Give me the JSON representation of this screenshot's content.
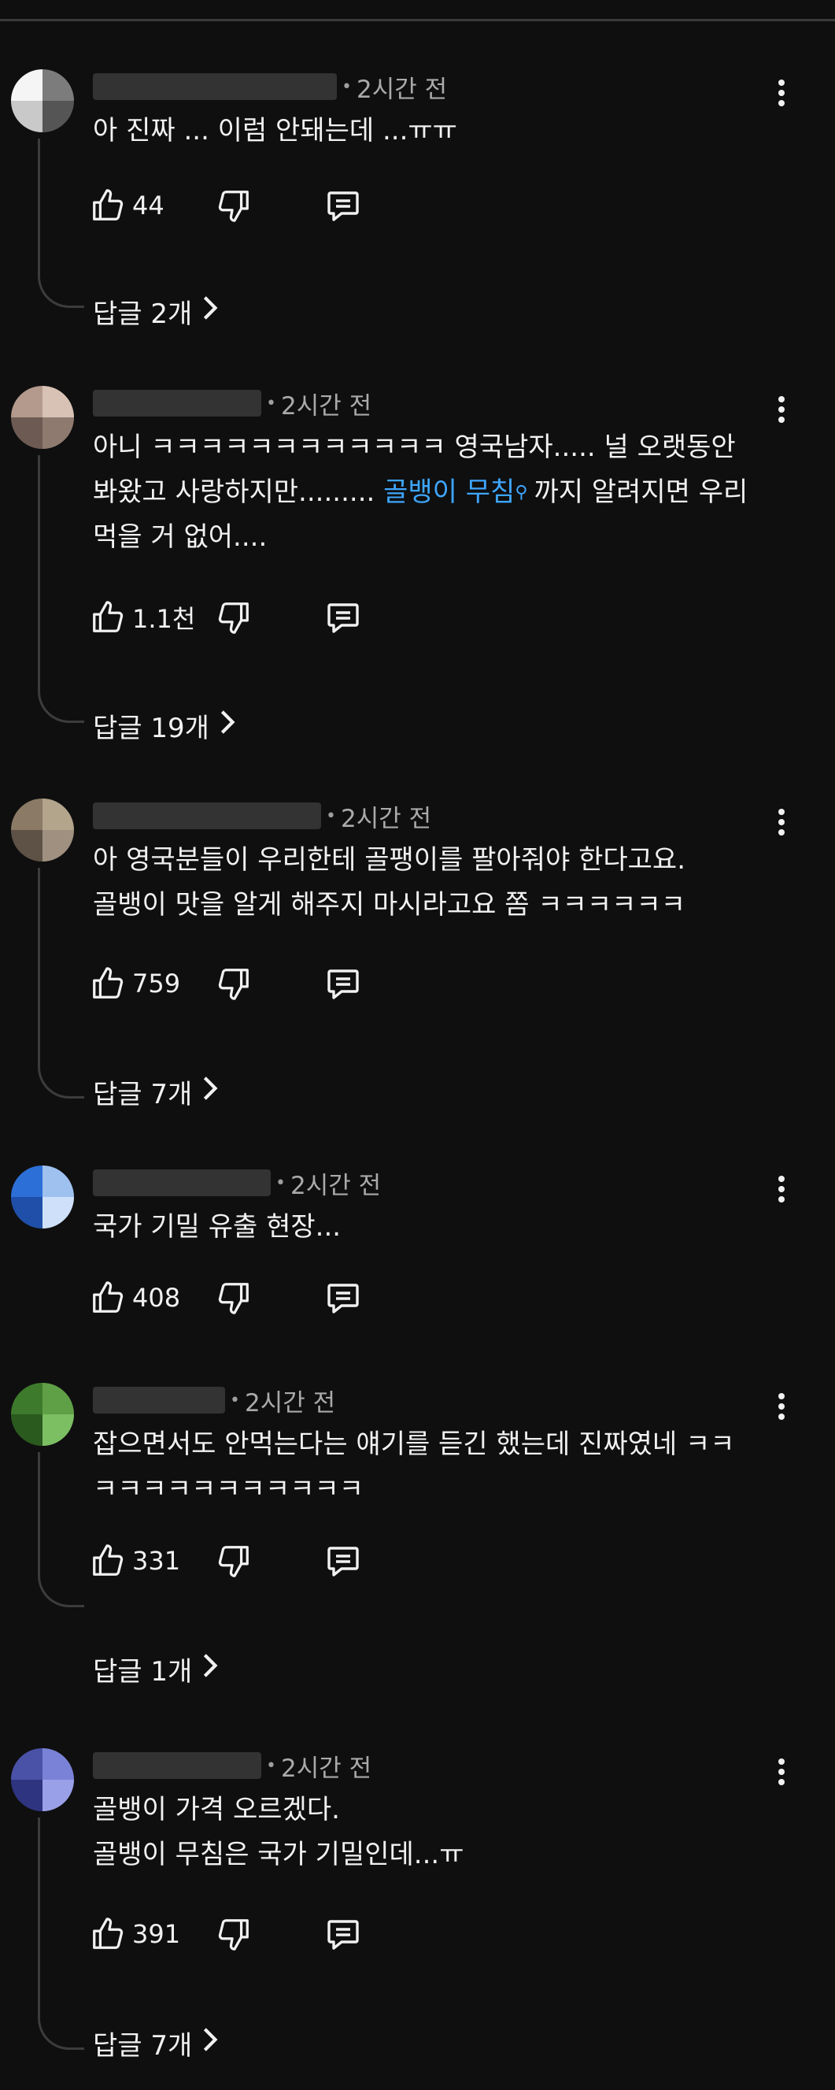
{
  "comments": [
    {
      "time": "2시간 전",
      "lines": [
        "아 진짜 ... 이럼 안돼는데 ...ㅠㅠ"
      ],
      "likes": "44",
      "replies": "답글 2개",
      "avatar_colors": [
        "#f5f5f5",
        "#7c7c7c",
        "#c9c9c9",
        "#555555"
      ]
    },
    {
      "time": "2시간 전",
      "line1": "아니 ㅋㅋㅋㅋㅋㅋㅋㅋㅋㅋㅋㅋ 영국남자..... 널 오랫동안",
      "line2_pre": "봐왔고 사랑하지만......... ",
      "link": "골뱅이 무침",
      "line2_post": "까지 알려지면 우리",
      "line3": "먹을 거 없어....",
      "likes": "1.1천",
      "replies": "답글 19개",
      "avatar_colors": [
        "#b39a8c",
        "#d8c2b5",
        "#6d5a52",
        "#8f7a70"
      ]
    },
    {
      "time": "2시간 전",
      "lines": [
        "아 영국분들이 우리한테 골팽이를 팔아줘야 한다고요.",
        "골뱅이 맛을 알게 해주지 마시라고요 쫌 ㅋㅋㅋㅋㅋㅋ"
      ],
      "likes": "759",
      "replies": "답글 7개",
      "avatar_colors": [
        "#8a7a66",
        "#b3a48c",
        "#5d5245",
        "#a09080"
      ]
    },
    {
      "time": "2시간 전",
      "lines": [
        "국가 기밀 유출 현장..."
      ],
      "likes": "408",
      "avatar_colors": [
        "#2c6fd6",
        "#9fc1f0",
        "#1f4fa8",
        "#cfe0fa"
      ]
    },
    {
      "time": "2시간 전",
      "lines": [
        "잡으면서도 안먹는다는 얘기를 듣긴 했는데 진짜였네 ㅋㅋ",
        "ㅋㅋㅋㅋㅋㅋㅋㅋㅋㅋㅋ"
      ],
      "likes": "331",
      "replies": "답글 1개",
      "avatar_colors": [
        "#3d7a2c",
        "#5fa046",
        "#2a5a1e",
        "#7cbf62"
      ]
    },
    {
      "time": "2시간 전",
      "lines": [
        "골뱅이 가격 오르겠다.",
        "골뱅이 무침은 국가 기밀인데...ㅠ"
      ],
      "likes": "391",
      "replies": "답글 7개",
      "avatar_colors": [
        "#4a52a8",
        "#7a82d8",
        "#2e3480",
        "#9aa0e8"
      ]
    }
  ]
}
